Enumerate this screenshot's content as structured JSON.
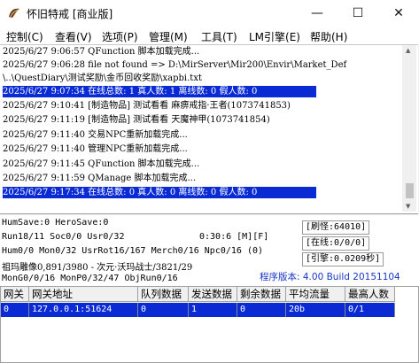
{
  "window": {
    "title": "怀旧特戒 [商业版]",
    "minimize_glyph": "—",
    "maximize_glyph": "☐",
    "close_glyph": "✕"
  },
  "menu": [
    "控制(C)",
    "查看(V)",
    "选项(P)",
    "管理(M)",
    "工具(T)",
    "LM引擎(E)",
    "帮助(H)"
  ],
  "log": [
    {
      "text": "2025/6/27 9:06:57 QFunction 脚本加载完成...",
      "selected": false
    },
    {
      "text": "2025/6/27 9:06:28 file not found => D:\\MirServer\\Mir200\\Envir\\Market_Def",
      "selected": false
    },
    {
      "text": "\\..\\QuestDiary\\测试奖励\\金币回收奖励\\xapbi.txt",
      "selected": false
    },
    {
      "text": "2025/6/27 9:07:34 在线总数: 1 真人数: 1 离线数: 0 假人数: 0",
      "selected": true
    },
    {
      "text": "2025/6/27 9:10:41 [制造物品] 测试看看 麻痹戒指·王者(1073741853)",
      "selected": false
    },
    {
      "text": "2025/6/27 9:11:19 [制造物品] 测试看看 天魔神甲(1073741854)",
      "selected": false
    },
    {
      "text": "2025/6/27 9:11:40 交易NPC重新加载完成...",
      "selected": false
    },
    {
      "text": "2025/6/27 9:11:40 管理NPC重新加载完成...",
      "selected": false
    },
    {
      "text": "2025/6/27 9:11:45 QFunction 脚本加载完成...",
      "selected": false
    },
    {
      "text": "2025/6/27 9:11:59 QManage 脚本加载完成...",
      "selected": false
    },
    {
      "text": "2025/6/27 9:17:34 在线总数: 0 真人数: 0 离线数: 0 假人数: 0",
      "selected": true
    }
  ],
  "status": {
    "line1": "HumSave:0 HeroSave:0",
    "line2": "Run18/11 Soc0/0 Usr0/32",
    "timer": "0:30:6 [M][F]",
    "line3": "Hum0/0 Mon0/32 UsrRot16/167 Merch0/16 Npc0/16 (0)",
    "line4": "祖玛雕像0,891/3980 - 次元·沃玛战士/3821/29",
    "line5": "MonG0/0/16 MonP0/32/47 ObjRun0/16",
    "refresh": "[刷怪:64010]",
    "online": "[在线:0/0/0]",
    "engine": "[引擎:0.0209秒]",
    "version": "程序版本: 4.00 Build 20151104"
  },
  "grid": {
    "headers": [
      "网关",
      "网关地址",
      "队列数据",
      "发送数据",
      "剩余数据",
      "平均流量",
      "最高人数"
    ],
    "rows": [
      [
        "0",
        "127.0.0.1:51624",
        "0",
        "1",
        "0",
        "20b",
        "0/1"
      ]
    ]
  },
  "colors": {
    "selection": "#0a2bd4",
    "version_text": "#1a35c6"
  }
}
